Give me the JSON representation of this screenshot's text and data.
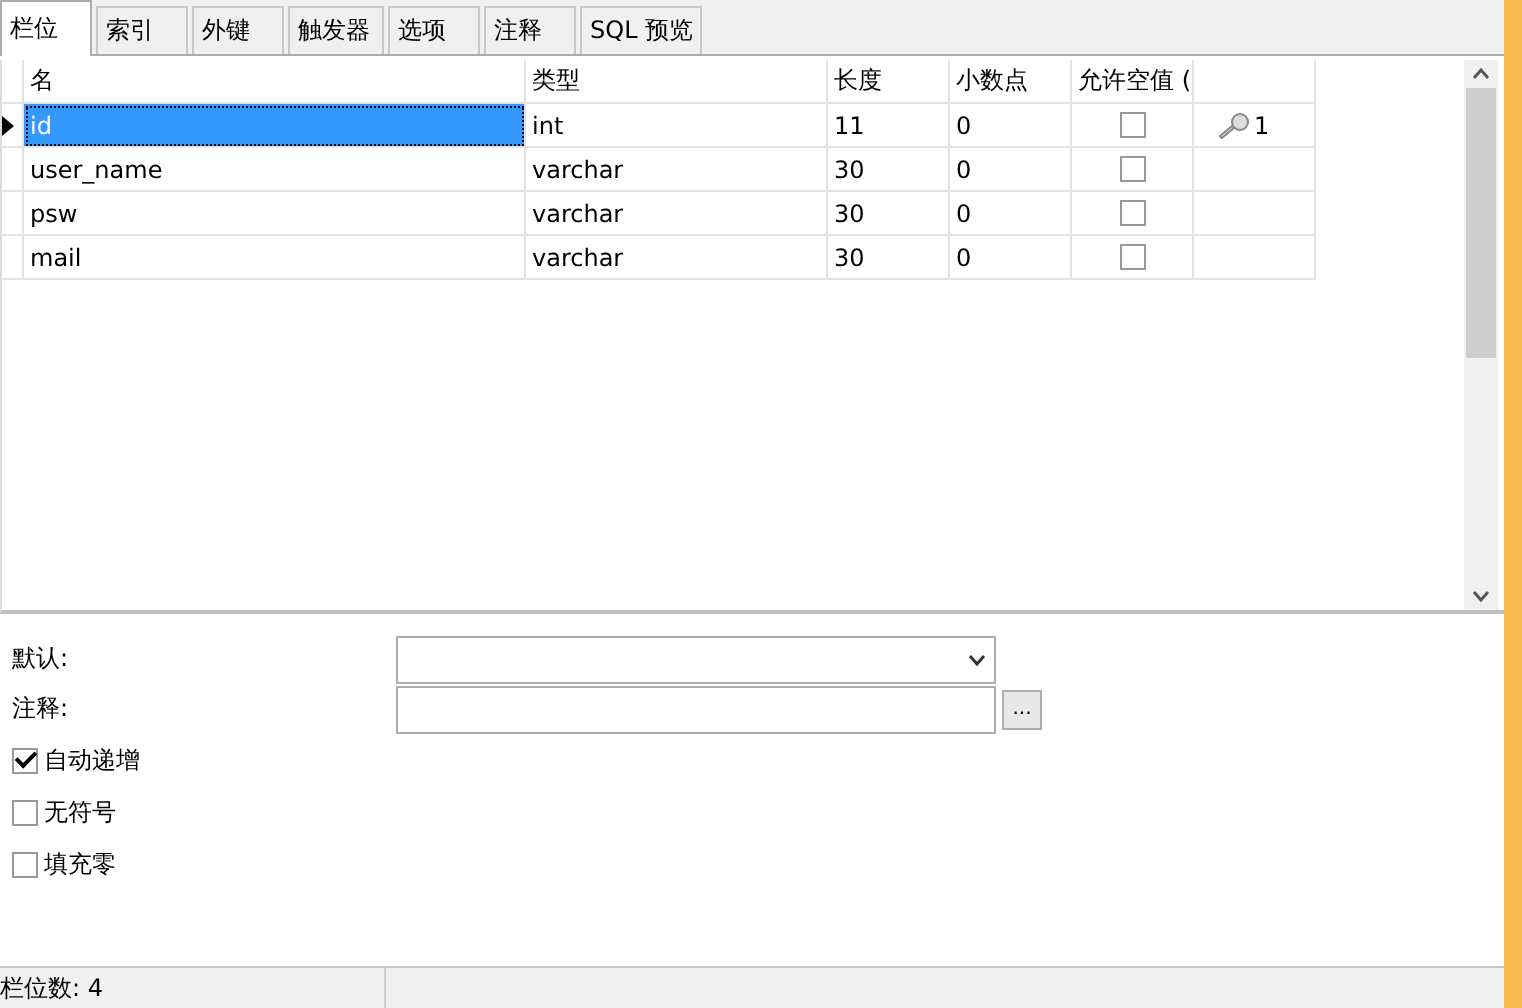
{
  "tabs": [
    {
      "label": "栏位",
      "selected": true
    },
    {
      "label": "索引",
      "selected": false
    },
    {
      "label": "外键",
      "selected": false
    },
    {
      "label": "触发器",
      "selected": false
    },
    {
      "label": "选项",
      "selected": false
    },
    {
      "label": "注释",
      "selected": false
    },
    {
      "label": "SQL 预览",
      "selected": false
    }
  ],
  "table": {
    "columns": [
      "名",
      "类型",
      "长度",
      "小数点",
      "允许空值 ("
    ],
    "rows": [
      {
        "name": "id",
        "type": "int",
        "length": "11",
        "decimals": "0",
        "allow_null": false,
        "key": "1",
        "selected": true
      },
      {
        "name": "user_name",
        "type": "varchar",
        "length": "30",
        "decimals": "0",
        "allow_null": false,
        "selected": false
      },
      {
        "name": "psw",
        "type": "varchar",
        "length": "30",
        "decimals": "0",
        "allow_null": false,
        "selected": false
      },
      {
        "name": "mail",
        "type": "varchar",
        "length": "30",
        "decimals": "0",
        "allow_null": false,
        "selected": false
      }
    ]
  },
  "properties": {
    "default_label": "默认:",
    "comment_label": "注释:",
    "comment_button": "...",
    "options": [
      {
        "label": "自动递增",
        "checked": true
      },
      {
        "label": "无符号",
        "checked": false
      },
      {
        "label": "填充零",
        "checked": false
      }
    ]
  },
  "status_bar": {
    "text": "栏位数: 4"
  }
}
